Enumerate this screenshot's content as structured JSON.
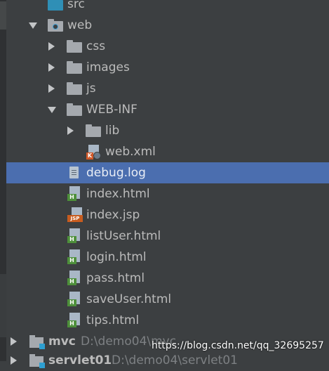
{
  "tree": {
    "src": "src",
    "web": "web",
    "css": "css",
    "images": "images",
    "js": "js",
    "webinf": "WEB-INF",
    "lib": "lib",
    "webxml": "web.xml",
    "debuglog": "debug.log",
    "index_html": "index.html",
    "index_jsp": "index.jsp",
    "listuser": "listUser.html",
    "login": "login.html",
    "pass": "pass.html",
    "saveuser": "saveUser.html",
    "tips": "tips.html",
    "mvc": "mvc",
    "mvc_path": "D:\\demo04\\mvc",
    "servlet": "servlet01",
    "servlet_path": "D:\\demo04\\servlet01"
  },
  "badges": {
    "html": "H",
    "jsp": "JSP",
    "xml": "K"
  },
  "watermark": "https://blog.csdn.net/qq_32695257",
  "colors": {
    "background": "#3c3f41",
    "selection": "#4b6eaf",
    "text": "#bbbbbb"
  }
}
